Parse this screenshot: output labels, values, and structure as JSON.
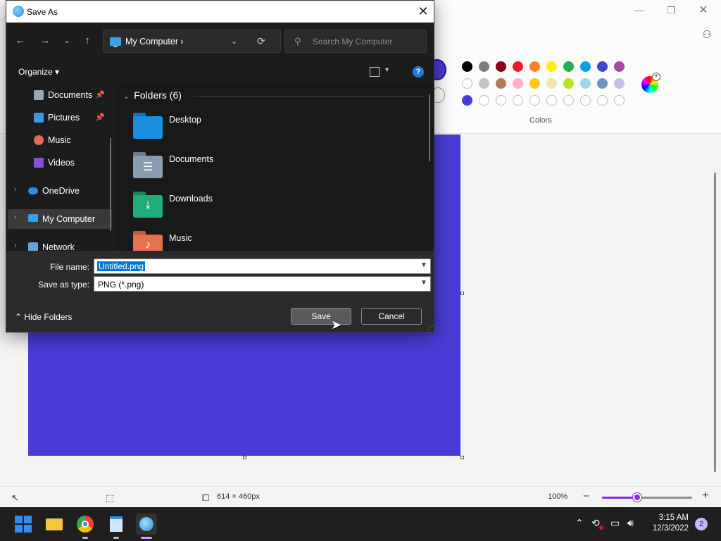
{
  "paint": {
    "colors_label": "Colors",
    "palette_row1": [
      "#000000",
      "#7f7f7f",
      "#880015",
      "#ed1c24",
      "#ff7f27",
      "#fff200",
      "#22b14c",
      "#00a2e8",
      "#3f48cc",
      "#a349a4"
    ],
    "palette_row2": [
      "empty",
      "#c3c3c3",
      "#b97a57",
      "#ffaec9",
      "#ffc90e",
      "#efe4b0",
      "#b5e61d",
      "#99d9ea",
      "#7092be",
      "#c8bfe7"
    ],
    "palette_row3": [
      "#4a3bd6",
      "empty",
      "empty",
      "empty",
      "empty",
      "empty",
      "empty",
      "empty",
      "empty",
      "empty"
    ],
    "canvas_color": "#4a3bd6",
    "status": {
      "canvas_size": "614 × 460px",
      "zoom": "100%",
      "zoom_level": 0.4
    }
  },
  "dialog": {
    "title": "Save As",
    "address": {
      "location": "My Computer",
      "separator": "›"
    },
    "search_placeholder": "Search My Computer",
    "organize_label": "Organize",
    "nav_items": [
      {
        "label": "Documents",
        "pinned": true
      },
      {
        "label": "Pictures",
        "pinned": true
      },
      {
        "label": "Music",
        "pinned": false
      },
      {
        "label": "Videos",
        "pinned": false
      },
      {
        "label": "OneDrive",
        "pinned": false
      },
      {
        "label": "My Computer",
        "pinned": false,
        "selected": true
      },
      {
        "label": "Network",
        "pinned": false
      }
    ],
    "group_header": "Folders (6)",
    "folders": [
      {
        "label": "Desktop",
        "color": "#1a8fe0"
      },
      {
        "label": "Documents",
        "color": "#8a9bb0"
      },
      {
        "label": "Downloads",
        "color": "#1fae7a"
      },
      {
        "label": "Music",
        "color": "#e3734f"
      }
    ],
    "file_name_label": "File name:",
    "file_name_value": "Untitled.png",
    "save_type_label": "Save as type:",
    "save_type_value": "PNG (*.png)",
    "hide_folders_label": "Hide Folders",
    "save_button": "Save",
    "cancel_button": "Cancel"
  },
  "taskbar": {
    "time": "3:15 AM",
    "date": "12/3/2022",
    "notification_count": "2"
  }
}
